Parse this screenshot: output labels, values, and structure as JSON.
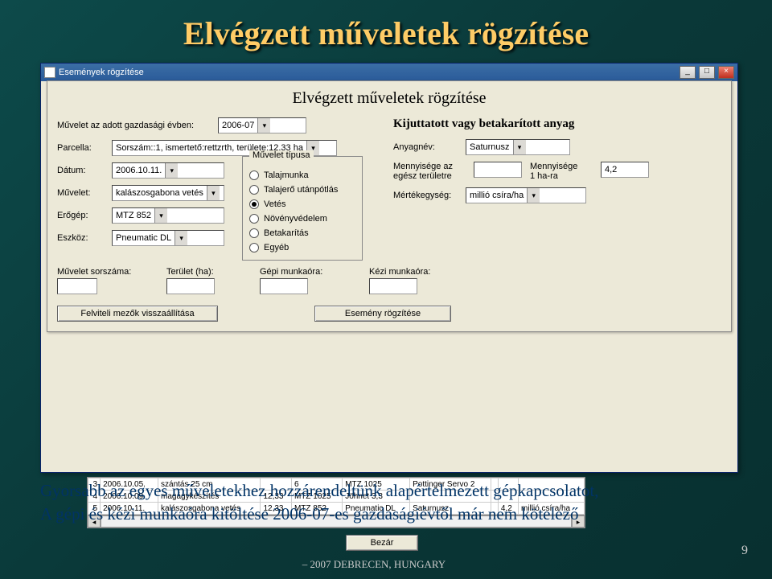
{
  "slide": {
    "title": "Elvégzett műveletek rögzítése",
    "page_number": "9",
    "footer_location": "– 2007 DEBRECEN, HUNGARY"
  },
  "outer_window": {
    "title": "Események rögzítése"
  },
  "dialog": {
    "title": "Elvégzett műveletek rögzítése",
    "year_label": "Művelet az adott gazdasági évben:",
    "year_value": "2006-07",
    "parcella_label": "Parcella:",
    "parcella_value": "Sorszám::1, ismertető:rettzrth, területe:12,33 ha",
    "datum_label": "Dátum:",
    "datum_value": "2006.10.11.",
    "muvelet_label": "Művelet:",
    "muvelet_value": "kalászosgabona vetés",
    "erogep_label": "Erőgép:",
    "erogep_value": "MTZ 852",
    "eszkoz_label": "Eszköz:",
    "eszkoz_value": "Pneumatic DL",
    "group_title": "Művelet típusa",
    "radios": [
      "Talajmunka",
      "Talajerő utánpótlás",
      "Vetés",
      "Növényvédelem",
      "Betakarítás",
      "Egyéb"
    ],
    "radio_selected": 2,
    "right_title": "Kijuttatott vagy betakarított anyag",
    "anyagnev_label": "Anyagnév:",
    "anyagnev_value": "Saturnusz",
    "menny_egesz_label1": "Mennyisége az",
    "menny_egesz_label2": "egész területre",
    "menny_1ha_label1": "Mennyisége",
    "menny_1ha_label2": "1 ha-ra",
    "menny_1ha_value": "4,2",
    "mertekegyseg_label": "Mértékegység:",
    "mertekegyseg_value": "millió csíra/ha",
    "bottom_labels": [
      "Művelet sorszáma:",
      "Terület (ha):",
      "Gépi munkaóra:",
      "Kézi munkaóra:"
    ],
    "btn_reset": "Felviteli mezők visszaállítása",
    "btn_save": "Esemény rögzítése"
  },
  "grid": {
    "rows": [
      [
        "3",
        "2006.10.05.",
        "szántás 25 cm",
        "",
        "6",
        "MTZ 1025",
        "Pottinger Servo 2",
        "",
        "",
        ""
      ],
      [
        "4",
        "2006.10.09.",
        "magágykészítés",
        "12,33",
        "MTZ 1025",
        "Jöhnet 3,3",
        "",
        "",
        "",
        ""
      ],
      [
        "5",
        "2006.10.11.",
        "kalászosgabona vetés",
        "12,33",
        "MTZ 852",
        "Pneumatic DL",
        "Saturnusz",
        "",
        "4,2",
        "millió csíra/ha"
      ]
    ]
  },
  "overlay_text": {
    "line1": "Gyorsabb az egyes műveletekhez hozzárendeltünk alapértelmezett gépkapcsolatot,",
    "line2": "A gépi és kézi munkaóra kitöltése 2006-07-es gazdaságiévtől már nem kötelező"
  },
  "close_btn": "Bezár"
}
